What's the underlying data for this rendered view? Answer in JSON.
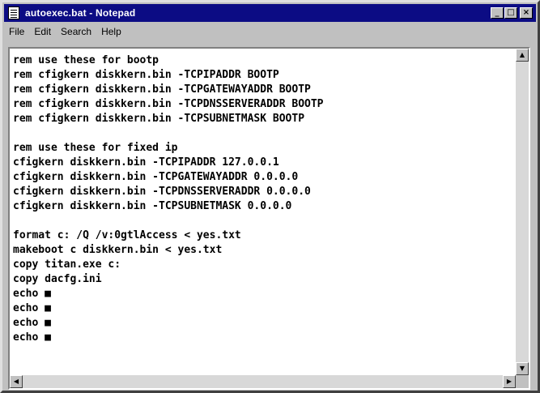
{
  "window": {
    "title": "autoexec.bat - Notepad"
  },
  "titlebar_buttons": {
    "minimize": "_",
    "maximize": "□",
    "close": "×"
  },
  "menu": [
    "File",
    "Edit",
    "Search",
    "Help"
  ],
  "lines": [
    "rem use these for bootp",
    "rem cfigkern diskkern.bin -TCPIPADDR BOOTP",
    "rem cfigkern diskkern.bin -TCPGATEWAYADDR BOOTP",
    "rem cfigkern diskkern.bin -TCPDNSSERVERADDR BOOTP",
    "rem cfigkern diskkern.bin -TCPSUBNETMASK BOOTP",
    "",
    "rem use these for fixed ip",
    "cfigkern diskkern.bin -TCPIPADDR 127.0.0.1",
    "cfigkern diskkern.bin -TCPGATEWAYADDR 0.0.0.0",
    "cfigkern diskkern.bin -TCPDNSSERVERADDR 0.0.0.0",
    "cfigkern diskkern.bin -TCPSUBNETMASK 0.0.0.0",
    "",
    "format c: /Q /v:0gtlAccess < yes.txt",
    "makeboot c diskkern.bin < yes.txt",
    "copy titan.exe c:",
    "copy dacfg.ini",
    "echo ■",
    "echo ■",
    "echo ■",
    "echo ■"
  ],
  "scrollbar": {
    "up": "▲",
    "down": "▼",
    "left": "◀",
    "right": "▶"
  }
}
